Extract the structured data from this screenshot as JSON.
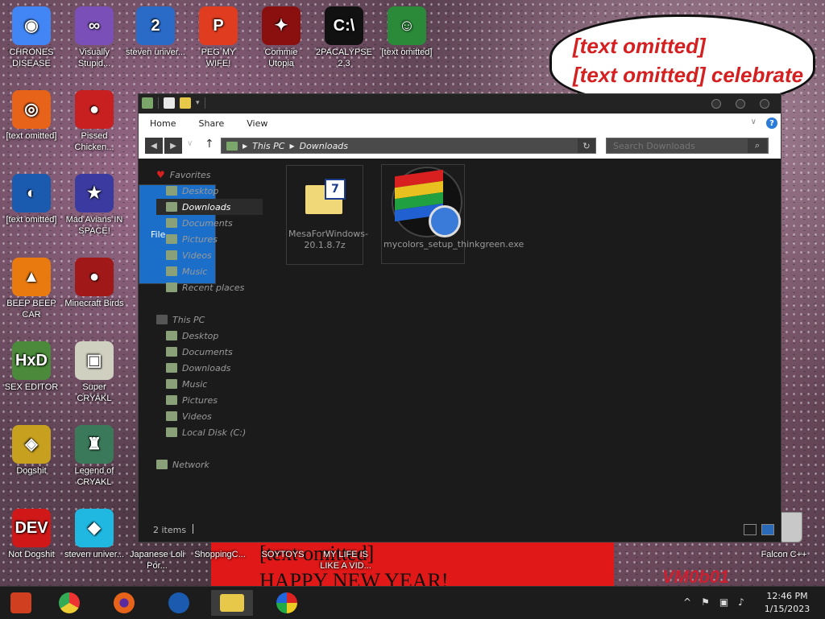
{
  "desktop": {
    "bubble_lines": [
      "[text omitted]",
      "[text omitted] celebrate"
    ],
    "banner_lines": [
      "[text omitted]",
      "HAPPY NEW YEAR!"
    ],
    "vm_label": "VM0b01",
    "icons": [
      {
        "label": "CHRONES DISEASE",
        "icon": "chrome-icon",
        "color": "#4285f4",
        "glyph": "◉"
      },
      {
        "label": "Visually Stupid...",
        "icon": "visual-studio-icon",
        "color": "#7b4fb8",
        "glyph": "∞"
      },
      {
        "label": "steven univer...",
        "icon": "blue-logo-icon",
        "color": "#2a6bc8",
        "glyph": "2"
      },
      {
        "label": "PEG MY WIFE!",
        "icon": "p-logo-icon",
        "color": "#e03c20",
        "glyph": "P"
      },
      {
        "label": "Commie Utopia",
        "icon": "red-logo-icon",
        "color": "#8a1010",
        "glyph": "✦"
      },
      {
        "label": "2PACALYPSE 2.3",
        "icon": "terminal-icon",
        "color": "#111111",
        "glyph": "C:\\"
      },
      {
        "label": "[text omitted]",
        "icon": "game-icon",
        "color": "#2a8a3a",
        "glyph": "☺"
      },
      {
        "label": "[text omitted]",
        "icon": "firefox-icon",
        "color": "#e8631a",
        "glyph": "◎"
      },
      {
        "label": "Pissed Chicken...",
        "icon": "bird-icon",
        "color": "#c82020",
        "glyph": "●"
      },
      {
        "label": "[text omitted]",
        "icon": "globe-logo-icon",
        "color": "#1a5bb0",
        "glyph": "◐"
      },
      {
        "label": "Mad Avians IN SPACE!",
        "icon": "space-bird-icon",
        "color": "#3a3aa0",
        "glyph": "★"
      },
      {
        "label": "BEEP BEEP CAR",
        "icon": "vlc-icon",
        "color": "#e87a10",
        "glyph": "▲"
      },
      {
        "label": "Minecraft Birds",
        "icon": "bird2-icon",
        "color": "#a01818",
        "glyph": "●"
      },
      {
        "label": "SEX EDITOR",
        "icon": "hex-editor-icon",
        "color": "#4a8a3a",
        "glyph": "HxD"
      },
      {
        "label": "Super CRYAKL",
        "icon": "pixel-dog-icon",
        "color": "#d0d0c0",
        "glyph": "▣"
      },
      {
        "label": "Dogshit",
        "icon": "disc-icon",
        "color": "#c8a020",
        "glyph": "◈"
      },
      {
        "label": "Legend of CRYAKL",
        "icon": "pixel-character-icon",
        "color": "#3a7a5a",
        "glyph": "♜"
      },
      {
        "label": "Not Dogshit",
        "icon": "dev-cpp-icon",
        "color": "#d01818",
        "glyph": "DEV"
      },
      {
        "label": "steven univer...",
        "icon": "diamond-icon",
        "color": "#20b8e0",
        "glyph": "◆"
      },
      {
        "label": "Japanese Loli Por...",
        "icon": "file-icon",
        "color": "#888888",
        "glyph": ""
      },
      {
        "label": "ShoppingC...",
        "icon": "file2-icon",
        "color": "#888888",
        "glyph": ""
      },
      {
        "label": "SOYTOYS",
        "icon": "file3-icon",
        "color": "#888888",
        "glyph": ""
      },
      {
        "label": "MY LIFE IS LIKE A VID...",
        "icon": "file4-icon",
        "color": "#888888",
        "glyph": ""
      },
      {
        "label": "Falcon C++",
        "icon": "falcon-icon",
        "color": "#888888",
        "glyph": ""
      }
    ]
  },
  "explorer": {
    "ribbon": {
      "file": "File",
      "home": "Home",
      "share": "Share",
      "view": "View",
      "help": "?"
    },
    "address": {
      "root": "This PC",
      "current": "Downloads"
    },
    "search_placeholder": "Search Downloads",
    "nav": {
      "favorites": "Favorites",
      "fav_items": [
        "Desktop",
        "Downloads",
        "Documents",
        "Pictures",
        "Videos",
        "Music",
        "Recent places"
      ],
      "this_pc": "This PC",
      "pc_items": [
        "Desktop",
        "Documents",
        "Downloads",
        "Music",
        "Pictures",
        "Videos",
        "Local Disk (C:)"
      ],
      "network": "Network"
    },
    "files": [
      {
        "name": "MesaForWindows-20.1.8.7z",
        "icon": "7zip-archive-icon"
      },
      {
        "name": "mycolors_setup_thinkgreen.exe",
        "icon": "mycolors-installer-icon"
      }
    ],
    "status": "2 items"
  },
  "taskbar": {
    "time": "12:46 PM",
    "date": "1/15/2023",
    "apps": [
      "start-icon",
      "chrome-icon",
      "firefox-icon",
      "globe-logo-icon",
      "file-explorer-icon",
      "mycolors-icon"
    ]
  }
}
